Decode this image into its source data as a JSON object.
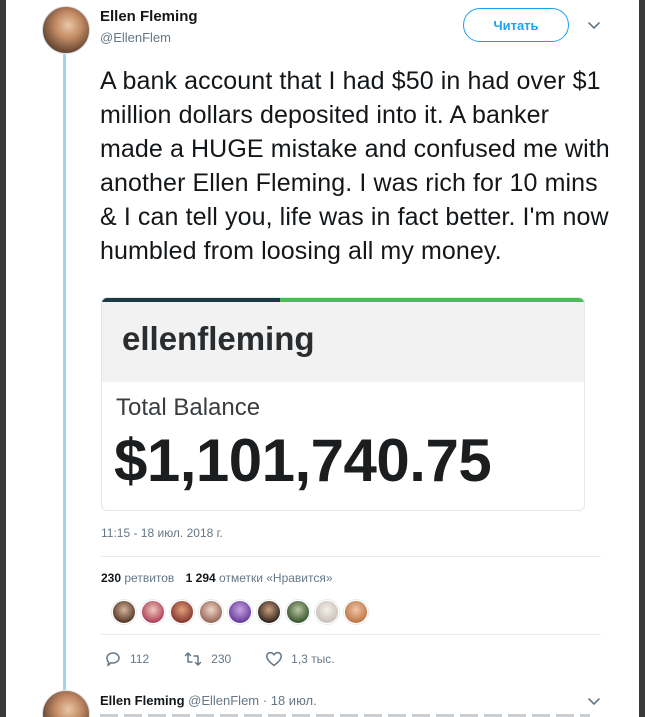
{
  "tweet": {
    "author_name": "Ellen Fleming",
    "author_handle": "@EllenFlem",
    "follow_label": "Читать",
    "text": "A bank account that I had $50 in had over $1 million dollars deposited into it. A banker made a HUGE mistake and confused me with another Ellen Fleming. I was rich for 10 mins & I can tell you, life was in fact better. I'm now humbled from loosing all my money.",
    "timestamp": "11:15 - 18 июл. 2018 г.",
    "stats": {
      "retweets_count": "230",
      "retweets_label": "ретвитов",
      "likes_count": "1 294",
      "likes_label": "отметки «Нравится»"
    },
    "actions": {
      "replies": "112",
      "retweets": "230",
      "likes": "1,3 тыс."
    },
    "icons": [
      "avatar",
      "chevron-down-icon",
      "reply-icon",
      "retweet-icon",
      "heart-icon"
    ]
  },
  "media": {
    "username": "ellenfleming",
    "balance_label": "Total Balance",
    "balance": "$1,101,740.75",
    "progress_fraction": 0.37,
    "progress_color": "#4cbb5a"
  },
  "liker_avatar_count": 9,
  "reply_preview": {
    "author_name": "Ellen Fleming",
    "author_handle": "@EllenFlem",
    "separator": "·",
    "date": "18 июл."
  },
  "colors": {
    "accent": "#1da1f2",
    "thread_line": "#a2d4ec",
    "muted_text": "#657786"
  }
}
